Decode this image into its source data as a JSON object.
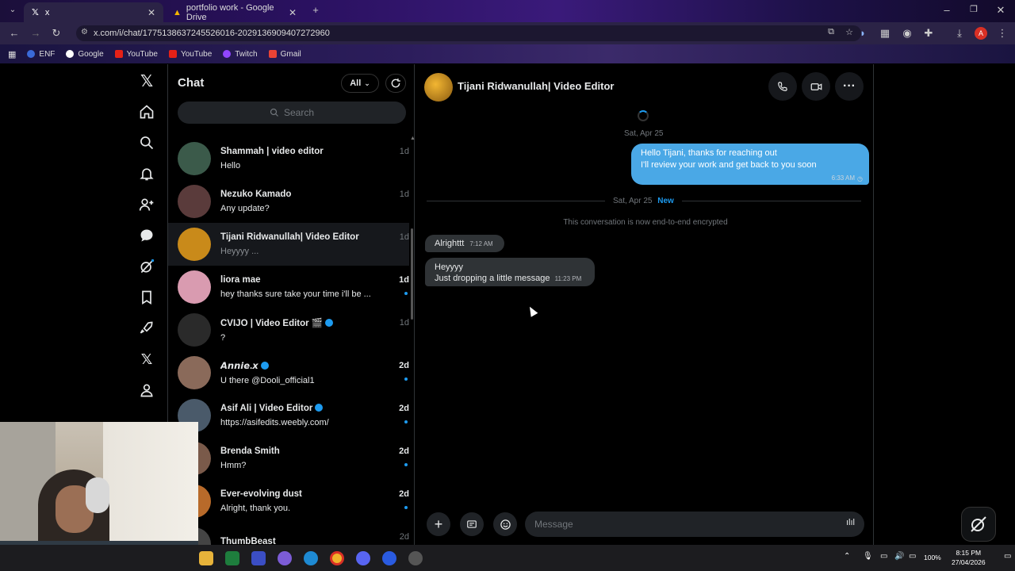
{
  "browser": {
    "tabs": [
      {
        "title": "x",
        "active": true
      },
      {
        "title": "portfolio work - Google Drive",
        "active": false
      }
    ],
    "url": "x.com/i/chat/1775138637245526016-2029136909407272960",
    "bookmarks": [
      "ENF",
      "Google",
      "YouTube",
      "YouTube",
      "Twitch",
      "Gmail"
    ]
  },
  "sidebar": {
    "title": "Chat",
    "filter_label": "All",
    "search_placeholder": "Search"
  },
  "conversations": [
    {
      "name": "Shammah | video editor",
      "message": "Hello",
      "time": "1d",
      "unread": false,
      "selected": false,
      "avatar_color": "#3b5a4a"
    },
    {
      "name": "Nezuko Kamado",
      "message": "Any update?",
      "time": "1d",
      "unread": false,
      "selected": false,
      "avatar_color": "#5a3b3b"
    },
    {
      "name": "Tijani Ridwanullah| Video Editor",
      "message": "Heyyyy ...",
      "time": "1d",
      "unread": false,
      "selected": true,
      "avatar_color": "#c98a1a"
    },
    {
      "name": "liora mae",
      "message": "hey thanks sure take your time i'll be ...",
      "time": "1d",
      "unread": true,
      "selected": false,
      "avatar_color": "#d99bb0"
    },
    {
      "name": "CVIJO | Video Editor 🎬",
      "message": "?",
      "time": "1d",
      "unread": false,
      "selected": false,
      "avatar_color": "#2a2a2a",
      "verified": true
    },
    {
      "name": "𝘼𝙣𝙣𝙞𝙚.𝙭",
      "message": "U there @Dooli_official1",
      "time": "2d",
      "unread": true,
      "selected": false,
      "avatar_color": "#8a6a5a",
      "verified": true
    },
    {
      "name": "Asif Ali | Video Editor",
      "message": "https://asifedits.weebly.com/",
      "time": "2d",
      "unread": true,
      "selected": false,
      "avatar_color": "#4a5a6a",
      "verified": true
    },
    {
      "name": "Brenda Smith",
      "message": "Hmm?",
      "time": "2d",
      "unread": true,
      "selected": false,
      "avatar_color": "#7a5a4a"
    },
    {
      "name": "Ever-evolving dust",
      "message": "Alright, thank you.",
      "time": "2d",
      "unread": true,
      "selected": false,
      "avatar_color": "#b86a2a"
    },
    {
      "name": "ThumbBeast",
      "message": "",
      "time": "2d",
      "unread": false,
      "selected": false,
      "avatar_color": "#444"
    }
  ],
  "conversation": {
    "name": "Tijani Ridwanullah| Video Editor",
    "date1": "Sat, Apr 25",
    "outgoing": {
      "line1": "Hello Tijani, thanks for reaching out",
      "line2": "I'll review your work and get back to you soon",
      "time": "6:33 AM"
    },
    "date2": "Sat, Apr 25",
    "date2_badge": "New",
    "encrypted_notice": "This conversation is now end-to-end encrypted",
    "incoming": [
      {
        "text": "Alrighttt",
        "time": "7:12 AM"
      },
      {
        "line1": "Heyyyy",
        "line2": "Just dropping a little message",
        "time": "11:23 PM"
      }
    ],
    "composer_placeholder": "Message"
  },
  "colors": {
    "accent": "#1d9bf0",
    "outgoing_bubble": "#4aa8e6",
    "incoming_bubble": "#2f3336"
  },
  "taskbar": {
    "battery": "100%",
    "time": "8:15 PM",
    "date": "27/04/2026"
  }
}
